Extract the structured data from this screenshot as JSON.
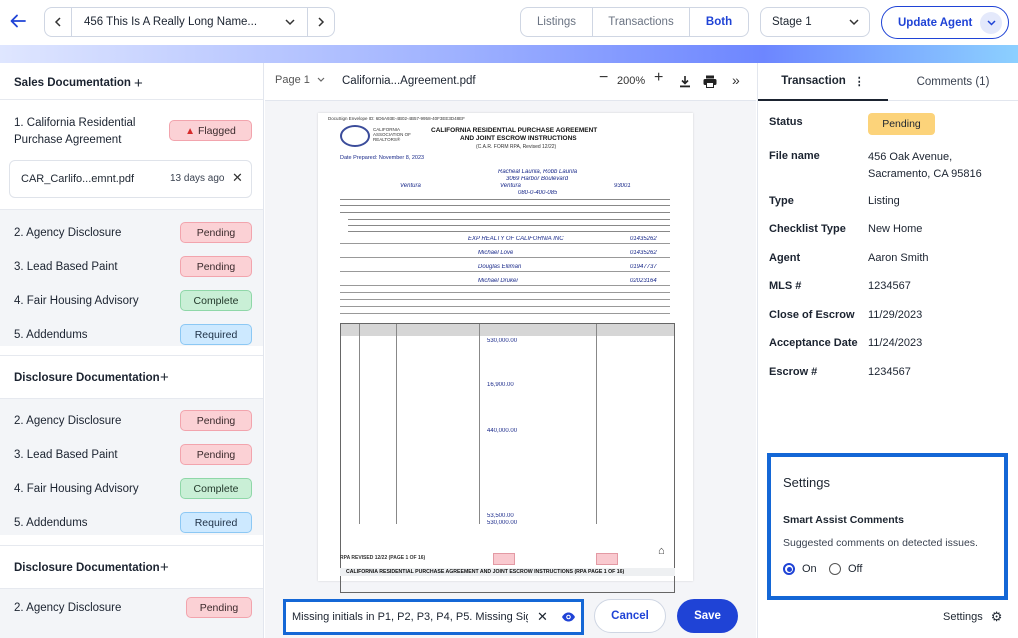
{
  "topbar": {
    "back_icon": "arrow-left-icon",
    "property_title": "456 This Is A Really Long Name...",
    "view_tabs": [
      "Listings",
      "Transactions",
      "Both"
    ],
    "active_view": "Both",
    "stage_select": "Stage 1",
    "update_button": "Update Agent"
  },
  "left": {
    "sections": [
      {
        "title": "Sales Documentation",
        "items": [
          {
            "label": "1. California Residential Purchase Agreement",
            "badge": "Flagged",
            "kind": "flag"
          },
          {
            "label": "2. Agency Disclosure",
            "badge": "Pending",
            "kind": "pending"
          },
          {
            "label": "3. Lead Based Paint",
            "badge": "Pending",
            "kind": "pending"
          },
          {
            "label": "4. Fair Housing Advisory",
            "badge": "Complete",
            "kind": "complete"
          },
          {
            "label": "5. Addendums",
            "badge": "Required",
            "kind": "required"
          }
        ]
      },
      {
        "title": "Disclosure Documentation",
        "items": [
          {
            "label": "2. Agency Disclosure",
            "badge": "Pending",
            "kind": "pending"
          },
          {
            "label": "3. Lead Based Paint",
            "badge": "Pending",
            "kind": "pending"
          },
          {
            "label": "4. Fair Housing Advisory",
            "badge": "Complete",
            "kind": "complete"
          },
          {
            "label": "5. Addendums",
            "badge": "Required",
            "kind": "required"
          }
        ]
      },
      {
        "title": "Disclosure Documentation",
        "items": [
          {
            "label": "2. Agency Disclosure",
            "badge": "Pending",
            "kind": "pending"
          }
        ]
      }
    ],
    "file": {
      "name": "CAR_Carlifo...emnt.pdf",
      "age": "13 days ago"
    }
  },
  "viewer": {
    "page_select": "Page 1",
    "file_name": "California...Agreement.pdf",
    "zoom": "200%",
    "note_value": "Missing initials in P1, P2, P3, P4, P5. Missing Sig",
    "cancel": "Cancel",
    "save": "Save"
  },
  "document": {
    "envelope": "DocuSign Envelope ID: 6D6A93E-4B02-4B57-9958-40F3EE3D48EF",
    "org": "CALIFORNIA ASSOCIATION OF REALTORS®",
    "title1": "CALIFORNIA RESIDENTIAL PURCHASE AGREEMENT",
    "title2": "AND JOINT ESCROW INSTRUCTIONS",
    "title3": "(C.A.R. FORM RPA, Revised 12/22)",
    "date_prepared": "Date Prepared: November 8, 2023",
    "buyer": "Racheal Laurila, Robb Laurila",
    "address": "3069 Harbor Boulevard",
    "city": "Ventura",
    "county": "Ventura",
    "zip": "93001",
    "parcel": "080-0-400-085",
    "brokerage1": "EXP REALTY OF CALIFORNIA INC",
    "license1": "01435262",
    "agent1": "Michael Love",
    "license2": "01435262",
    "brokerage2": "Douglas Elliman",
    "license3": "01947737",
    "agent2": "Michael Druker",
    "license4": "02023164",
    "price": "530,000.00",
    "deposit": "16,900.00",
    "loan": "440,000.00",
    "down": "53,500.00",
    "total": "530,000.00",
    "footer": "RPA REVISED 12/22 (PAGE 1 OF 16)",
    "footer_title": "CALIFORNIA RESIDENTIAL PURCHASE AGREEMENT AND JOINT ESCROW INSTRUCTIONS (RPA PAGE 1 OF 16)"
  },
  "right": {
    "tabs": [
      "Transaction",
      "Comments (1)"
    ],
    "status_label": "Status",
    "status": "Pending",
    "fields": [
      {
        "k": "File name",
        "v": "456 Oak Avenue, Sacramento, CA 95816"
      },
      {
        "k": "Type",
        "v": "Listing"
      },
      {
        "k": "Checklist Type",
        "v": "New Home"
      },
      {
        "k": "Agent",
        "v": "Aaron Smith"
      },
      {
        "k": "MLS #",
        "v": "1234567"
      },
      {
        "k": "Close of Escrow",
        "v": "11/29/2023"
      },
      {
        "k": "Acceptance Date",
        "v": "11/24/2023"
      },
      {
        "k": "Escrow #",
        "v": "1234567"
      }
    ],
    "settings": {
      "title": "Settings",
      "subtitle": "Smart Assist Comments",
      "desc": "Suggested comments on detected issues.",
      "on": "On",
      "off": "Off",
      "selected": "On"
    },
    "settings_link": "Settings"
  },
  "colors": {
    "accent": "#1f43d6",
    "highlight": "#1467d6",
    "pending_status": "#fcd37a"
  }
}
